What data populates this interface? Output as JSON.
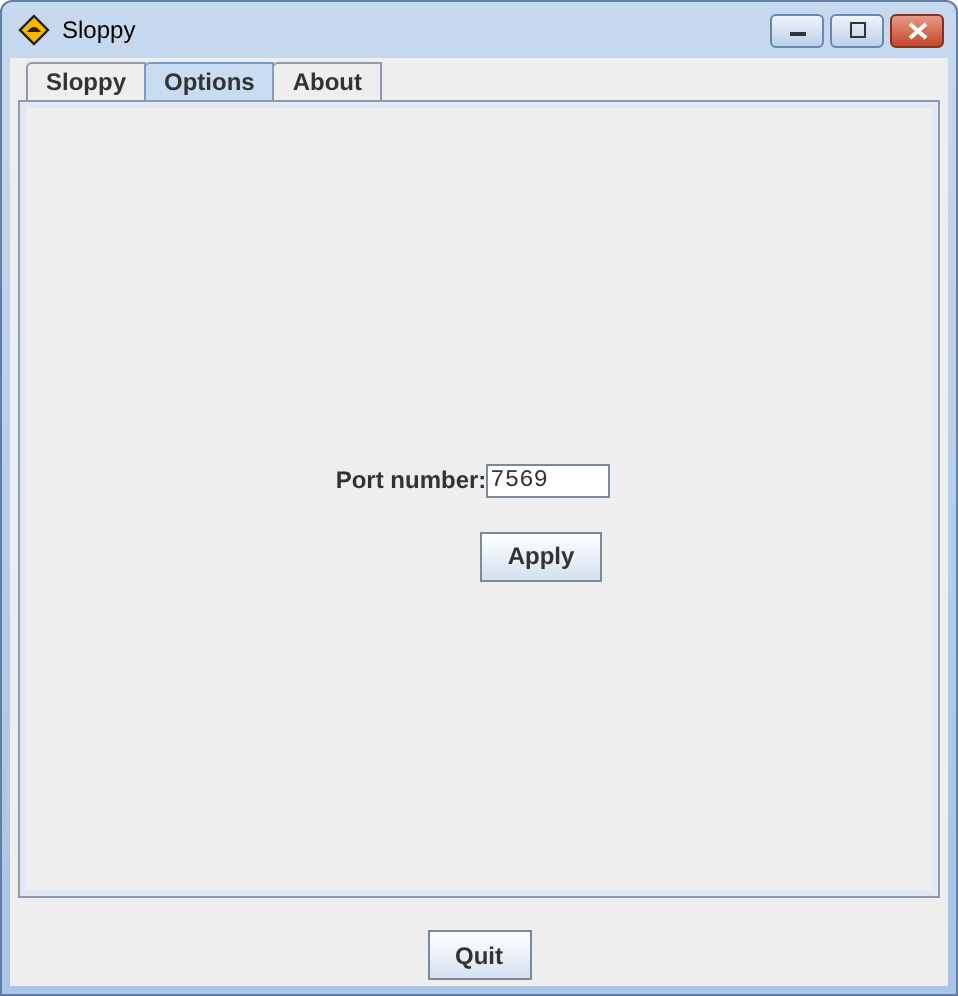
{
  "window": {
    "title": "Sloppy"
  },
  "tabs": [
    {
      "label": "Sloppy",
      "selected": false
    },
    {
      "label": "Options",
      "selected": true
    },
    {
      "label": "About",
      "selected": false
    }
  ],
  "port": {
    "label": "Port number:",
    "value": "7569"
  },
  "apply_button": "Apply",
  "quit_button": "Quit"
}
